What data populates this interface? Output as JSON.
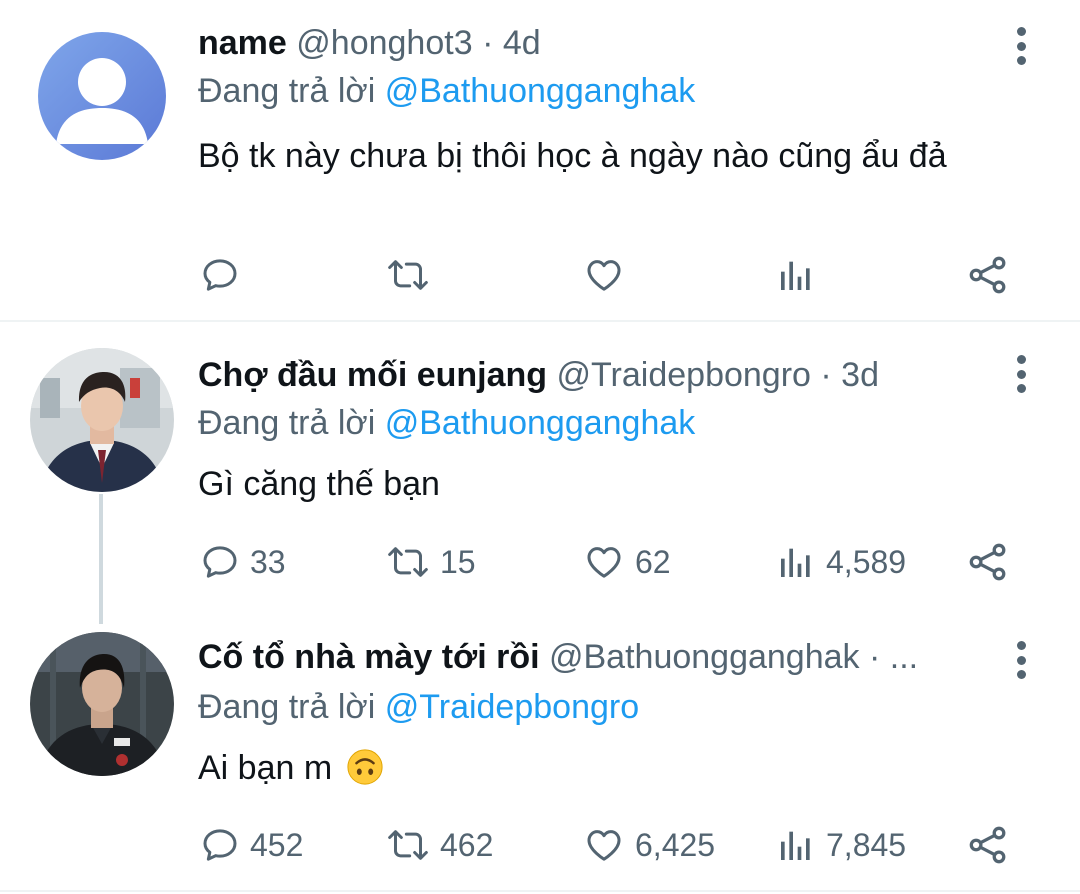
{
  "tweets": [
    {
      "name": "name",
      "handle": "@honghot3",
      "separator": "·",
      "time": "4d",
      "reply_prefix": "Đang trả lời",
      "reply_to": "@Bathuongganghak",
      "text": "Bộ tk này chưa bị thôi học à ngày nào cũng ẩu đả",
      "counts": {
        "replies": "",
        "retweets": "",
        "likes": "",
        "views": ""
      }
    },
    {
      "name": "Chợ đầu mối eunjang",
      "handle": "@Traidepbongro",
      "separator": "·",
      "time": "3d",
      "reply_prefix": "Đang trả lời",
      "reply_to": "@Bathuongganghak",
      "text": "Gì căng thế bạn",
      "counts": {
        "replies": "33",
        "retweets": "15",
        "likes": "62",
        "views": "4,589"
      }
    },
    {
      "name": "Cố tổ nhà mày tới rồi",
      "handle": "@Bathuongganghak",
      "separator": "·",
      "time": "...",
      "reply_prefix": "Đang trả lời",
      "reply_to": "@Traidepbongro",
      "text": "Ai bạn m",
      "emoji": "upside-down-face",
      "counts": {
        "replies": "452",
        "retweets": "462",
        "likes": "6,425",
        "views": "7,845"
      }
    }
  ],
  "colors": {
    "text": "#0f1419",
    "secondary": "#536471",
    "mention": "#1d9bf0",
    "divider": "#eff3f4",
    "default_avatar": "#6c8ee0"
  },
  "icons": [
    "reply-icon",
    "retweet-icon",
    "like-icon",
    "views-icon",
    "share-icon",
    "more-options-icon"
  ]
}
